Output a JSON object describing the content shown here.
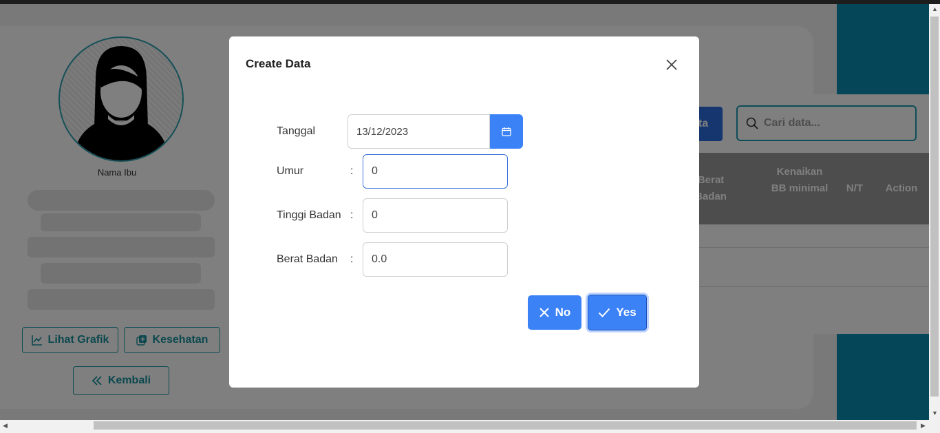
{
  "profile": {
    "name_label": "Nama Ibu",
    "buttons": {
      "lihat_grafik": "Lihat Grafik",
      "kesehatan": "Kesehatan",
      "kembali": "Kembali"
    }
  },
  "table": {
    "add_button_partial": "ata",
    "search_placeholder": "Cari data...",
    "headers": {
      "berat_badan": "Berat Badan",
      "kenaikan": "Kenaikan BB minimal",
      "nt": "N/T",
      "action": "Action"
    }
  },
  "modal": {
    "title": "Create Data",
    "fields": {
      "tanggal": {
        "label": "Tanggal",
        "value": "13/12/2023"
      },
      "umur": {
        "label": "Umur",
        "colon": ":",
        "value": "0"
      },
      "tinggi_badan": {
        "label": "Tinggi Badan",
        "colon": ":",
        "value": "0"
      },
      "berat_badan": {
        "label": "Berat Badan",
        "colon": ":",
        "value": "0.0"
      }
    },
    "no_label": "No",
    "yes_label": "Yes"
  },
  "colors": {
    "primary": "#3b82f6",
    "teal": "#1c9aa8",
    "overlay": "rgba(0,0,0,0.5)"
  }
}
